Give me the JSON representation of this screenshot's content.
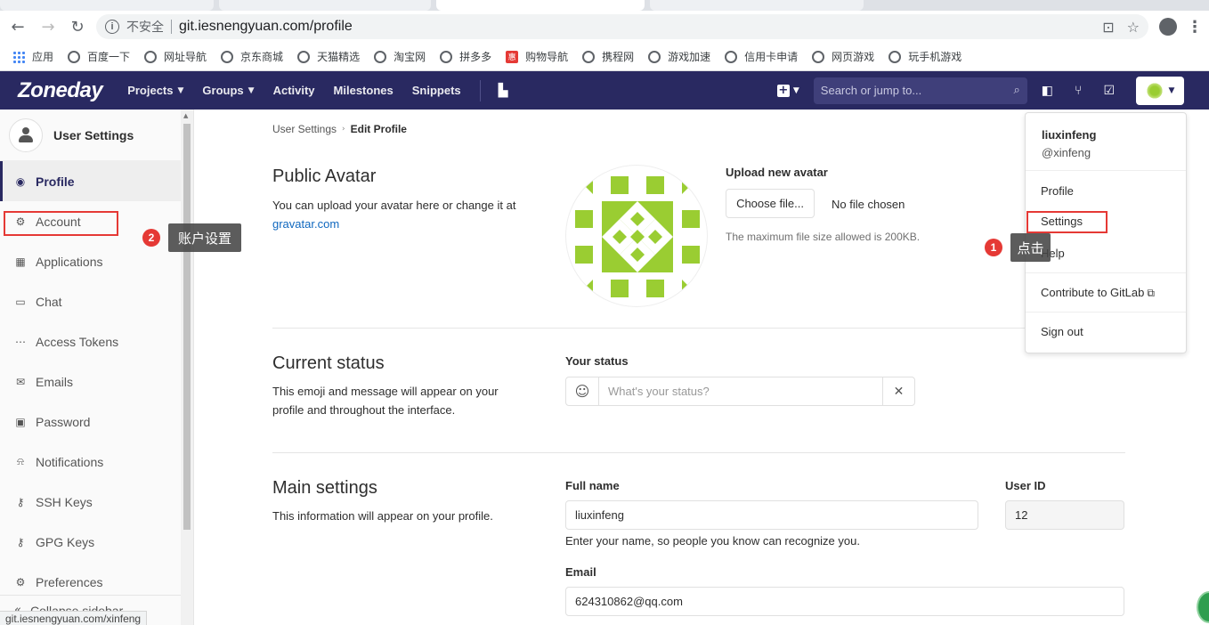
{
  "browser": {
    "security_label": "不安全",
    "url": "git.iesnengyuan.com/profile",
    "status_url": "git.iesnengyuan.com/xinfeng",
    "bookmarks": [
      "应用",
      "百度一下",
      "网址导航",
      "京东商城",
      "天猫精选",
      "淘宝网",
      "拼多多",
      "购物导航",
      "携程网",
      "游戏加速",
      "信用卡申请",
      "网页游戏",
      "玩手机游戏"
    ]
  },
  "header": {
    "logo": "Zoneday",
    "nav": {
      "projects": "Projects",
      "groups": "Groups",
      "activity": "Activity",
      "milestones": "Milestones",
      "snippets": "Snippets"
    },
    "search_placeholder": "Search or jump to..."
  },
  "sidebar": {
    "title": "User Settings",
    "items": [
      "Profile",
      "Account",
      "Applications",
      "Chat",
      "Access Tokens",
      "Emails",
      "Password",
      "Notifications",
      "SSH Keys",
      "GPG Keys",
      "Preferences"
    ],
    "collapse": "Collapse sidebar"
  },
  "breadcrumb": {
    "parent": "User Settings",
    "current": "Edit Profile"
  },
  "avatar_section": {
    "title": "Public Avatar",
    "desc": "You can upload your avatar here or change it at",
    "link": "gravatar.com",
    "upload_label": "Upload new avatar",
    "choose_button": "Choose file...",
    "no_file": "No file chosen",
    "max_size": "The maximum file size allowed is 200KB."
  },
  "status_section": {
    "title": "Current status",
    "desc_line1": "This emoji and message will appear on your",
    "desc_line2": "profile and throughout the interface.",
    "label": "Your status",
    "placeholder": "What's your status?"
  },
  "main_section": {
    "title": "Main settings",
    "desc": "This information will appear on your profile.",
    "full_name_label": "Full name",
    "full_name_value": "liuxinfeng",
    "full_name_help": "Enter your name, so people you know can recognize you.",
    "user_id_label": "User ID",
    "user_id_value": "12",
    "email_label": "Email",
    "email_value": "624310862@qq.com"
  },
  "dropdown": {
    "name": "liuxinfeng",
    "handle": "@xinfeng",
    "profile": "Profile",
    "settings": "Settings",
    "help": "Help",
    "contribute": "Contribute to GitLab",
    "sign_out": "Sign out"
  },
  "annotations": {
    "step1_num": "1",
    "step1_text": "点击",
    "step2_num": "2",
    "step2_text": "账户设置",
    "highlight_color": "#e53935"
  },
  "colors": {
    "header_bg": "#292961",
    "avatar_green": "#9acd32",
    "link": "#1068bf"
  }
}
